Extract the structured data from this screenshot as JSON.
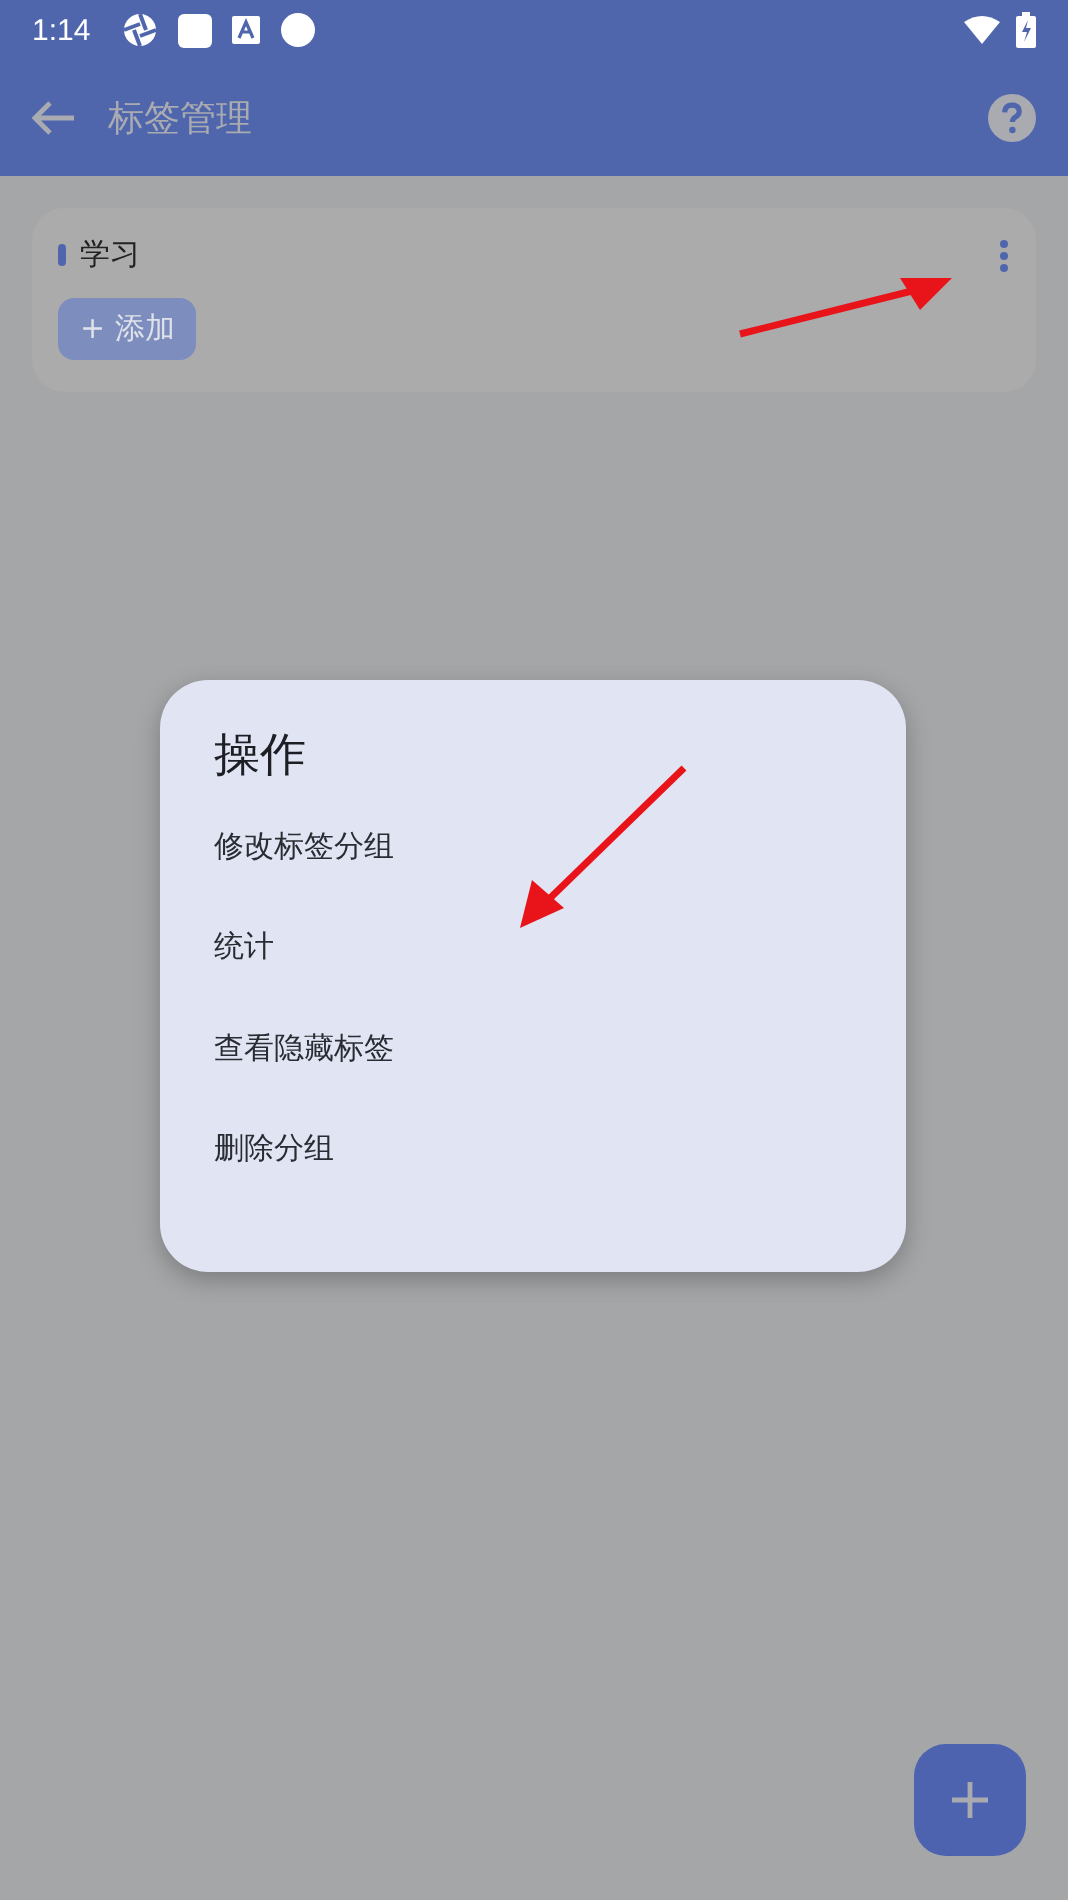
{
  "status_bar": {
    "time": "1:14"
  },
  "app_bar": {
    "title": "标签管理"
  },
  "groups": [
    {
      "name": "学习",
      "add_button": "+ 添加"
    }
  ],
  "dialog": {
    "title": "操作",
    "items": [
      "修改标签分组",
      "统计",
      "查看隐藏标签",
      "删除分组"
    ]
  }
}
